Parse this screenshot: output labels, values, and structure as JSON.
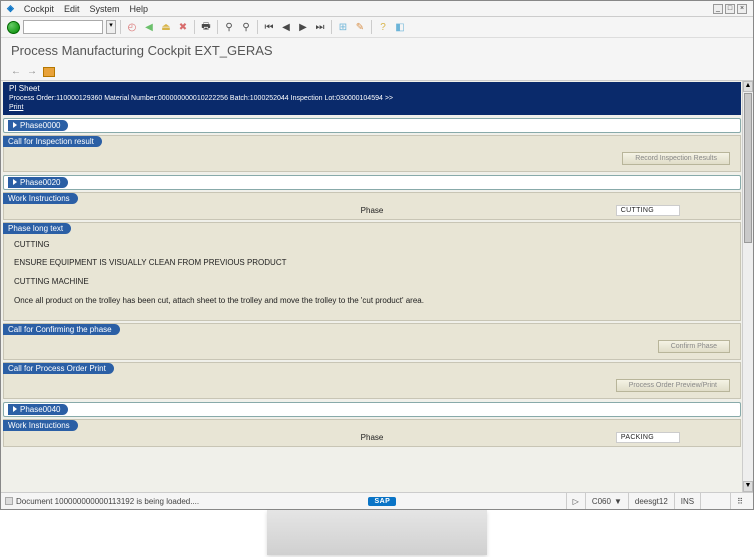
{
  "menu": {
    "m1": "Cockpit",
    "m2": "Edit",
    "m3": "System",
    "m4": "Help"
  },
  "page_title": "Process Manufacturing Cockpit EXT_GERAS",
  "header": {
    "title": "PI Sheet",
    "line2": "Process Order:110000129360    Material Number:000000000010222256    Batch:1000252044    Inspection Lot:030000104594   >>",
    "print": "Print"
  },
  "phases": {
    "p0": "Phase0000",
    "p20": "Phase0020",
    "p40": "Phase0040"
  },
  "sections": {
    "call_insp": "Call for Inspection result",
    "work_instr": "Work Instructions",
    "phase_longtext": "Phase long text",
    "call_confirm": "Call for Confirming the phase",
    "call_print": "Call for Process Order Print"
  },
  "labels": {
    "phase": "Phase"
  },
  "values": {
    "phase20": "CUTTING",
    "phase40": "PACKING"
  },
  "buttons": {
    "record_insp": "Record Inspection Results",
    "confirm_phase": "Confirm Phase",
    "po_preview": "Process Order Preview/Print"
  },
  "longtext": {
    "l1": "CUTTING",
    "l2": "ENSURE EQUIPMENT IS VISUALLY CLEAN FROM PREVIOUS PRODUCT",
    "l3": "CUTTING MACHINE",
    "l4": "Once all product on the trolley has been cut, attach sheet to the trolley and move the trolley to the 'cut product' area."
  },
  "status": {
    "msg": "Document 100000000000113192 is being loaded....",
    "sap": "SAP",
    "client": "C060",
    "user": "deesgt12",
    "mode": "INS"
  }
}
